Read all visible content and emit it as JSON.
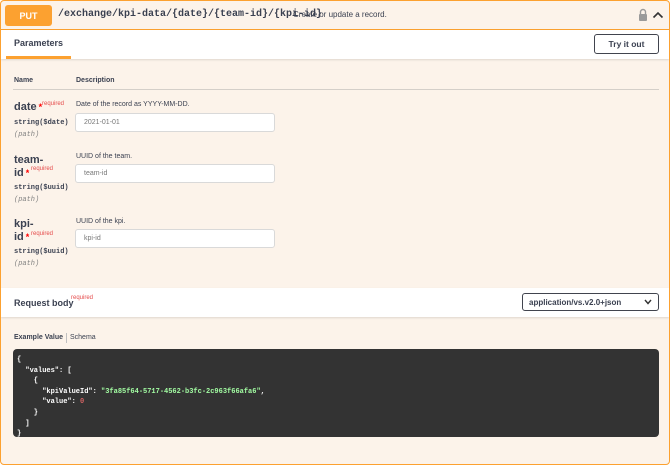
{
  "endpoint": {
    "method": "PUT",
    "path": "/exchange/kpi-data/{date}/{team-id}/{kpi-id}",
    "summary": "Create or update a record."
  },
  "parameters_section": {
    "tab_label": "Parameters",
    "try_button": "Try it out",
    "columns": {
      "name": "Name",
      "description": "Description"
    }
  },
  "params": [
    {
      "name_line1": "date",
      "name_line2": "",
      "required": "required",
      "type": "string($date)",
      "in": "(path)",
      "description": "Date of the record as YYYY-MM-DD.",
      "placeholder": "2021-01-01"
    },
    {
      "name_line1": "team-",
      "name_line2": "id",
      "required": "required",
      "type": "string($uuid)",
      "in": "(path)",
      "description": "UUID of the team.",
      "placeholder": "team-id"
    },
    {
      "name_line1": "kpi-",
      "name_line2": "id",
      "required": "required",
      "type": "string($uuid)",
      "in": "(path)",
      "description": "UUID of the kpi.",
      "placeholder": "kpi-id"
    }
  ],
  "request_body": {
    "title": "Request body",
    "required": "required",
    "content_type": "application/vs.v2.0+json",
    "tab_example": "Example Value",
    "tab_schema": "Schema",
    "example": {
      "l1": "{",
      "l2_key": "  \"values\": [",
      "l3": "    {",
      "l4_key": "      \"kpiValueId\": ",
      "l4_val": "\"3fa85f64-5717-4562-b3fc-2c963f66afa6\"",
      "l4_end": ",",
      "l5_key": "      \"value\": ",
      "l5_val": "0",
      "l6": "    }",
      "l7": "  ]",
      "l8": "}"
    }
  },
  "colors": {
    "put_accent": "#fca130",
    "block_bg": "#fcf3ea",
    "code_bg": "#333333"
  }
}
